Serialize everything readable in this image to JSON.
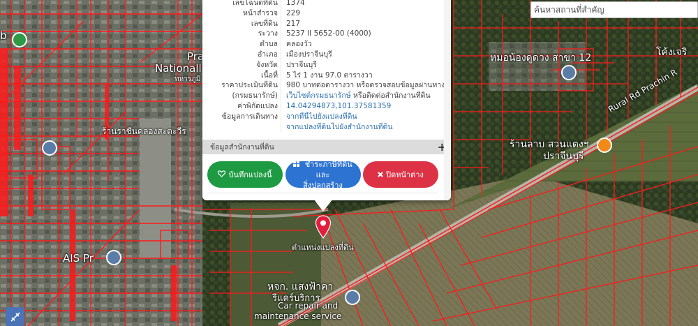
{
  "search": {
    "placeholder": "ค้นหาสถานที่สำคัญ"
  },
  "map_labels": {
    "b_fragment": "b",
    "pra": "Pra",
    "national": "Nationall",
    "thai_small": "ทหารภูมิ",
    "rajini": "ร้านราชีนคลองสะตะวีร",
    "moo_nong": "หมอน้องดูดวง สาขา 12",
    "khong": "โค้งเจริ",
    "rural_rd": "Rural Rd Prachin R",
    "ran_lap": "ร้านลาบ สวนแตงฯ",
    "prachinburi": "ปราจีนบุรี",
    "ais": "AIS Pr",
    "marker": "ตำแหน่งแปลงที่ดิน",
    "hjk": "หจก. แสงฟ้าคา",
    "rimkarn": "รีแคร์บริการ",
    "car_repair": "Car repair and",
    "maintenance": "maintenance service"
  },
  "popup": {
    "rows": [
      {
        "label": "เลขโฉนดที่ดิน",
        "value": "1374"
      },
      {
        "label": "หน้าสำรวจ",
        "value": "229"
      },
      {
        "label": "เลขที่ดิน",
        "value": "217"
      },
      {
        "label": "ระวาง",
        "value": "5237 II 5652-00 (4000)"
      },
      {
        "label": "ตำบล",
        "value": "คลองวัว"
      },
      {
        "label": "อำเภอ",
        "value": "เมืองปราจีนบุรี"
      },
      {
        "label": "จังหวัด",
        "value": "ปราจีนบุรี"
      },
      {
        "label": "เนื้อที่",
        "value": "5 ไร่ 1 งาน 97.0 ตารางวา"
      },
      {
        "label": "ราคาประเมินที่ดิน",
        "value": "980 บาทต่อตารางวา หรือตรวจสอบข้อมูลผ่านทาง"
      },
      {
        "label": "(กรมธนารักษ์)",
        "value_link": "เว็บไซต์กรมธนารักษ์",
        "value_suffix": " หรือติดต่อสำนักงานที่ดิน"
      },
      {
        "label": "ค่าพิกัดแปลง",
        "value_link": "14.04294873,101.37581359"
      },
      {
        "label": "ข้อมูลการเดินทาง",
        "value_link": "จากที่นี่ไปยังแปลงที่ดิน"
      },
      {
        "label": "",
        "value_link": "จากแปลงที่ดินไปยังสำนักงานที่ดิน"
      }
    ],
    "section_title": "ข้อมูลสำนักงานที่ดิน",
    "section_toggle": "+",
    "buttons": {
      "save": "บันทึกแปลงนี้",
      "tax_line1": "ชำระภาษีที่ดินและ",
      "tax_line2": "สิ่งปลูกสร้าง",
      "close": "ปิดหน้าต่าง"
    }
  },
  "icons": {
    "save": "heart-icon",
    "tax": "grid-icon",
    "close": "x-icon",
    "tool": "ruler-icon",
    "marker": "map-pin-icon"
  },
  "colors": {
    "parcel_lines": "#ff1a1a",
    "save_button": "#1e9b42",
    "tax_button": "#2c73d2",
    "close_button": "#dd3245",
    "link": "#2a6fb0"
  }
}
